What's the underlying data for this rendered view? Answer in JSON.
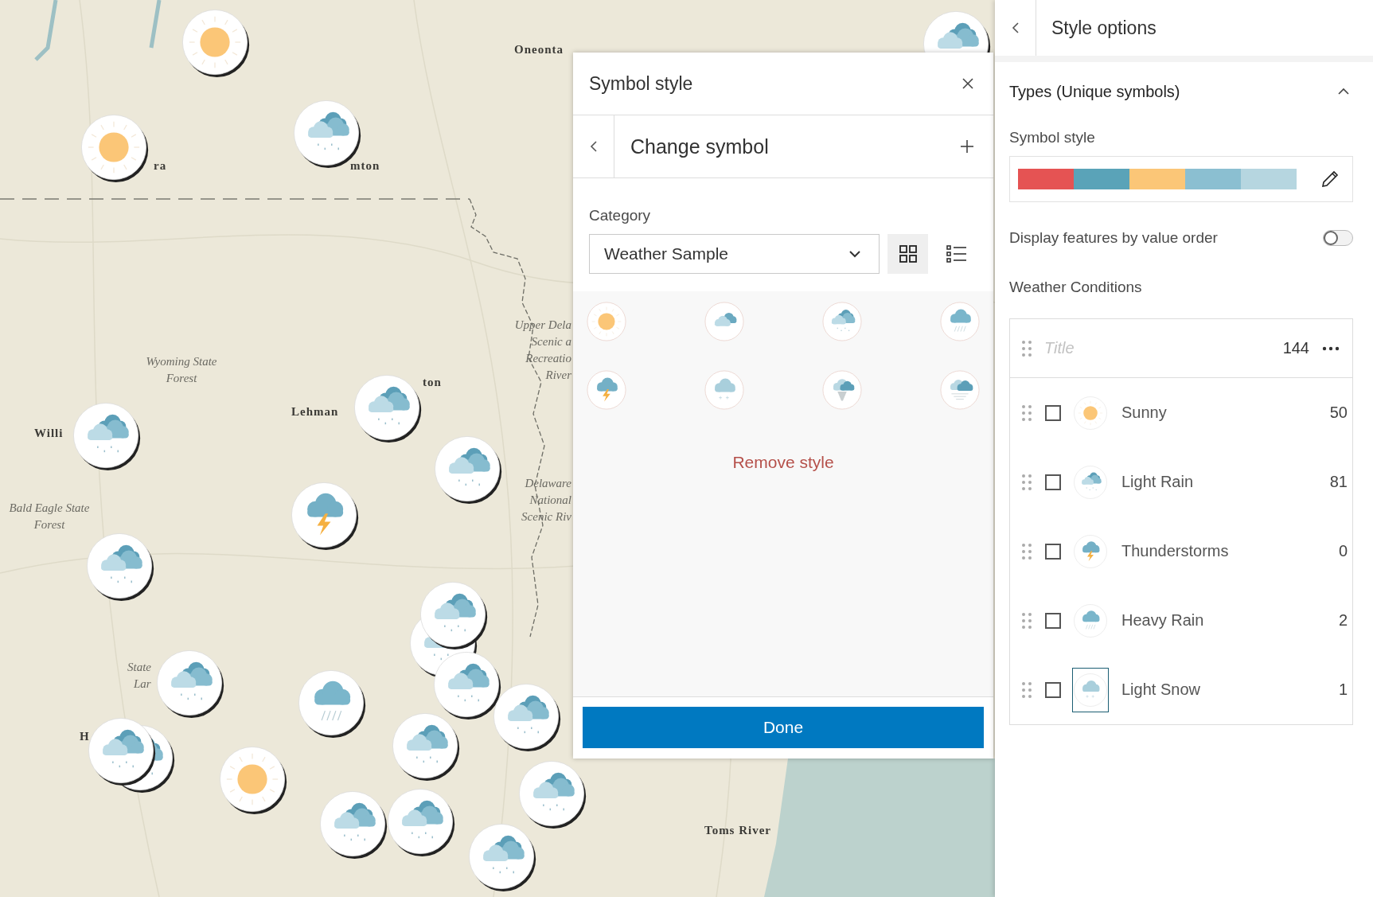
{
  "map": {
    "labels": [
      {
        "text": "Oneonta",
        "kind": "city"
      },
      {
        "text": "ra",
        "kind": "city"
      },
      {
        "text": "mton",
        "kind": "city"
      },
      {
        "text": "Wyoming State Forest",
        "kind": "park"
      },
      {
        "text": "ton",
        "kind": "city"
      },
      {
        "text": "Lehman",
        "kind": "city"
      },
      {
        "text": "Willi",
        "kind": "city"
      },
      {
        "text": "Upper Dela",
        "kind": "park"
      },
      {
        "text": "Scenic a",
        "kind": "park"
      },
      {
        "text": "Recreatio",
        "kind": "park"
      },
      {
        "text": "River",
        "kind": "park"
      },
      {
        "text": "Bald Eagle State Forest",
        "kind": "park"
      },
      {
        "text": "Delaware",
        "kind": "park"
      },
      {
        "text": "National",
        "kind": "park"
      },
      {
        "text": "Scenic Riv",
        "kind": "park"
      },
      {
        "text": "State",
        "kind": "park"
      },
      {
        "text": "Lar",
        "kind": "park"
      },
      {
        "text": "H",
        "kind": "city"
      },
      {
        "text": "Toms River",
        "kind": "city"
      }
    ],
    "markers": [
      {
        "kind": "sunny"
      },
      {
        "kind": "sunny"
      },
      {
        "kind": "light_rain"
      },
      {
        "kind": "light_rain"
      },
      {
        "kind": "light_rain"
      },
      {
        "kind": "light_rain"
      },
      {
        "kind": "thunderstorm"
      },
      {
        "kind": "light_rain"
      },
      {
        "kind": "light_rain"
      },
      {
        "kind": "light_rain"
      },
      {
        "kind": "light_rain"
      },
      {
        "kind": "heavy_rain"
      },
      {
        "kind": "light_rain"
      },
      {
        "kind": "light_rain"
      },
      {
        "kind": "light_rain"
      },
      {
        "kind": "light_rain"
      },
      {
        "kind": "sunny"
      },
      {
        "kind": "light_rain"
      },
      {
        "kind": "light_rain"
      },
      {
        "kind": "light_rain"
      },
      {
        "kind": "light_rain"
      },
      {
        "kind": "light_rain"
      },
      {
        "kind": "light_rain"
      }
    ]
  },
  "symbol_dialog": {
    "title": "Symbol style",
    "subtitle": "Change symbol",
    "category_label": "Category",
    "category_value": "Weather Sample",
    "views": [
      {
        "kind": "grid",
        "selected": true
      },
      {
        "kind": "list",
        "selected": false
      }
    ],
    "symbols": [
      {
        "kind": "sunny"
      },
      {
        "kind": "cloudy"
      },
      {
        "kind": "light_rain"
      },
      {
        "kind": "heavy_rain"
      },
      {
        "kind": "thunderstorm"
      },
      {
        "kind": "snow"
      },
      {
        "kind": "tornado"
      },
      {
        "kind": "wind"
      }
    ],
    "remove_label": "Remove style",
    "done_label": "Done"
  },
  "style_options": {
    "title": "Style options",
    "section": {
      "title": "Types (Unique symbols)",
      "expanded": true
    },
    "symbol_style_label": "Symbol style",
    "ramp_colors": [
      {
        "color": "#e55353"
      },
      {
        "color": "#5aa3b8"
      },
      {
        "color": "#fbc677"
      },
      {
        "color": "#8bbfd1"
      },
      {
        "color": "#b6d6e0"
      }
    ],
    "value_order": {
      "label": "Display features by value order",
      "on": false
    },
    "field_label": "Weather Conditions",
    "list_header": {
      "placeholder": "Title",
      "count": "144"
    },
    "categories": [
      {
        "name": "Sunny",
        "count": "50",
        "kind": "sunny",
        "checked": false,
        "focused": false
      },
      {
        "name": "Light Rain",
        "count": "81",
        "kind": "light_rain",
        "checked": false,
        "focused": false
      },
      {
        "name": "Thunderstorms",
        "count": "0",
        "kind": "thunderstorm",
        "checked": false,
        "focused": false
      },
      {
        "name": "Heavy Rain",
        "count": "2",
        "kind": "heavy_rain",
        "checked": false,
        "focused": false
      },
      {
        "name": "Light Snow",
        "count": "1",
        "kind": "snow",
        "checked": false,
        "focused": true
      }
    ]
  }
}
